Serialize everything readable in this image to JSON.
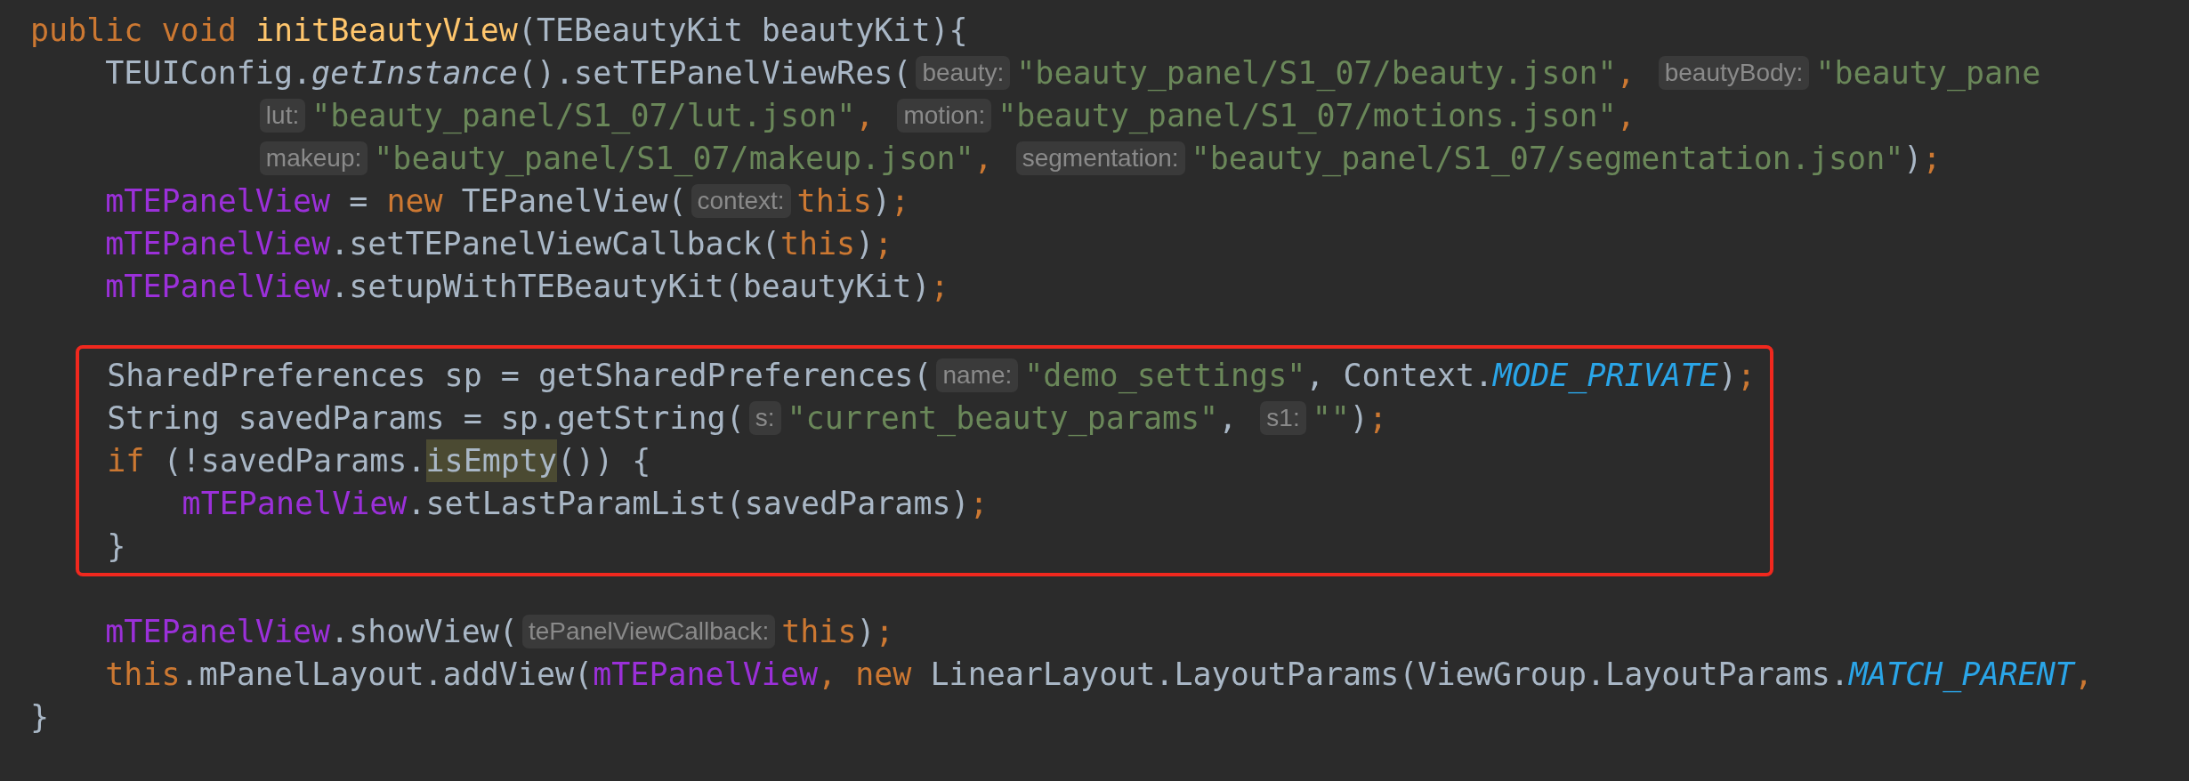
{
  "code": [
    {
      "kind": "line",
      "tokens": [
        {
          "kind": "kw",
          "text": "public void "
        },
        {
          "kind": "decl",
          "text": "initBeautyView"
        },
        {
          "kind": "plain",
          "text": "(TEBeautyKit beautyKit){"
        }
      ],
      "children": [
        {
          "kind": "line",
          "tokens": [
            {
              "kind": "plain",
              "text": "TEUIConfig."
            },
            {
              "kind": "italic",
              "text": "getInstance"
            },
            {
              "kind": "plain",
              "text": "().setTEPanelViewRes("
            },
            {
              "kind": "hint",
              "text": "beauty:"
            },
            {
              "kind": "str",
              "text": "\"beauty_panel/S1_07/beauty.json\""
            },
            {
              "kind": "kw",
              "text": ", "
            },
            {
              "kind": "hint",
              "text": "beautyBody:"
            },
            {
              "kind": "str",
              "text": "\"beauty_pane"
            }
          ],
          "children": [
            {
              "kind": "continuation",
              "tokens": [
                {
                  "kind": "hint",
                  "text": "lut:"
                },
                {
                  "kind": "str",
                  "text": "\"beauty_panel/S1_07/lut.json\""
                },
                {
                  "kind": "kw",
                  "text": ", "
                },
                {
                  "kind": "hint",
                  "text": "motion:"
                },
                {
                  "kind": "str",
                  "text": "\"beauty_panel/S1_07/motions.json\""
                },
                {
                  "kind": "kw",
                  "text": ","
                }
              ]
            },
            {
              "kind": "continuation",
              "tokens": [
                {
                  "kind": "hint",
                  "text": "makeup:"
                },
                {
                  "kind": "str",
                  "text": "\"beauty_panel/S1_07/makeup.json\""
                },
                {
                  "kind": "kw",
                  "text": ", "
                },
                {
                  "kind": "hint",
                  "text": "segmentation:"
                },
                {
                  "kind": "str",
                  "text": "\"beauty_panel/S1_07/segmentation.json\""
                },
                {
                  "kind": "plain",
                  "text": ")"
                },
                {
                  "kind": "kw",
                  "text": ";"
                }
              ]
            }
          ]
        },
        {
          "kind": "line",
          "tokens": [
            {
              "kind": "field",
              "text": "mTEPanelView"
            },
            {
              "kind": "plain",
              "text": " = "
            },
            {
              "kind": "kw",
              "text": "new "
            },
            {
              "kind": "plain",
              "text": "TEPanelView("
            },
            {
              "kind": "hint",
              "text": "context:"
            },
            {
              "kind": "kw",
              "text": "this"
            },
            {
              "kind": "plain",
              "text": ")"
            },
            {
              "kind": "kw",
              "text": ";"
            }
          ]
        },
        {
          "kind": "line",
          "tokens": [
            {
              "kind": "field",
              "text": "mTEPanelView"
            },
            {
              "kind": "plain",
              "text": ".setTEPanelViewCallback("
            },
            {
              "kind": "kw",
              "text": "this"
            },
            {
              "kind": "plain",
              "text": ")"
            },
            {
              "kind": "kw",
              "text": ";"
            }
          ]
        },
        {
          "kind": "line",
          "tokens": [
            {
              "kind": "field",
              "text": "mTEPanelView"
            },
            {
              "kind": "plain",
              "text": ".setupWithTEBeautyKit(beautyKit)"
            },
            {
              "kind": "kw",
              "text": ";"
            }
          ]
        },
        {
          "kind": "blank"
        },
        {
          "kind": "box",
          "lines": [
            {
              "kind": "line",
              "tokens": [
                {
                  "kind": "plain",
                  "text": "SharedPreferences sp = getSharedPreferences("
                },
                {
                  "kind": "hint",
                  "text": "name:"
                },
                {
                  "kind": "str",
                  "text": "\"demo_settings\""
                },
                {
                  "kind": "plain",
                  "text": ", Context."
                },
                {
                  "kind": "const",
                  "text": "MODE_PRIVATE"
                },
                {
                  "kind": "plain",
                  "text": ")"
                },
                {
                  "kind": "kw",
                  "text": ";"
                }
              ]
            },
            {
              "kind": "line",
              "tokens": [
                {
                  "kind": "plain",
                  "text": "String savedParams = sp.getString("
                },
                {
                  "kind": "hint",
                  "text": "s:"
                },
                {
                  "kind": "str",
                  "text": "\"current_beauty_params\""
                },
                {
                  "kind": "plain",
                  "text": ", "
                },
                {
                  "kind": "hint",
                  "text": "s1:"
                },
                {
                  "kind": "str",
                  "text": "\"\""
                },
                {
                  "kind": "plain",
                  "text": ")"
                },
                {
                  "kind": "kw",
                  "text": ";"
                }
              ]
            },
            {
              "kind": "line",
              "tokens": [
                {
                  "kind": "kw",
                  "text": "if "
                },
                {
                  "kind": "plain",
                  "text": "(!savedParams."
                },
                {
                  "kind": "match",
                  "text": "isEmpty"
                },
                {
                  "kind": "plain",
                  "text": "()) {"
                }
              ],
              "children": [
                {
                  "kind": "line",
                  "tokens": [
                    {
                      "kind": "field",
                      "text": "mTEPanelView"
                    },
                    {
                      "kind": "plain",
                      "text": ".setLastParamList(savedParams)"
                    },
                    {
                      "kind": "kw",
                      "text": ";"
                    }
                  ]
                }
              ]
            },
            {
              "kind": "line",
              "tokens": [
                {
                  "kind": "plain",
                  "text": "}"
                }
              ]
            }
          ]
        },
        {
          "kind": "blank"
        },
        {
          "kind": "line",
          "tokens": [
            {
              "kind": "field",
              "text": "mTEPanelView"
            },
            {
              "kind": "plain",
              "text": ".showView("
            },
            {
              "kind": "hint",
              "text": "tePanelViewCallback:"
            },
            {
              "kind": "kw",
              "text": "this"
            },
            {
              "kind": "plain",
              "text": ")"
            },
            {
              "kind": "kw",
              "text": ";"
            }
          ]
        },
        {
          "kind": "line",
          "tokens": [
            {
              "kind": "kw",
              "text": "this"
            },
            {
              "kind": "plain",
              "text": ".mPanelLayout.addView("
            },
            {
              "kind": "field",
              "text": "mTEPanelView"
            },
            {
              "kind": "kw",
              "text": ", new "
            },
            {
              "kind": "plain",
              "text": "LinearLayout.LayoutParams(ViewGroup.LayoutParams."
            },
            {
              "kind": "const",
              "text": "MATCH_PARENT"
            },
            {
              "kind": "kw",
              "text": ","
            }
          ]
        }
      ]
    },
    {
      "kind": "line",
      "tokens": [
        {
          "kind": "plain",
          "text": "}"
        }
      ]
    }
  ]
}
